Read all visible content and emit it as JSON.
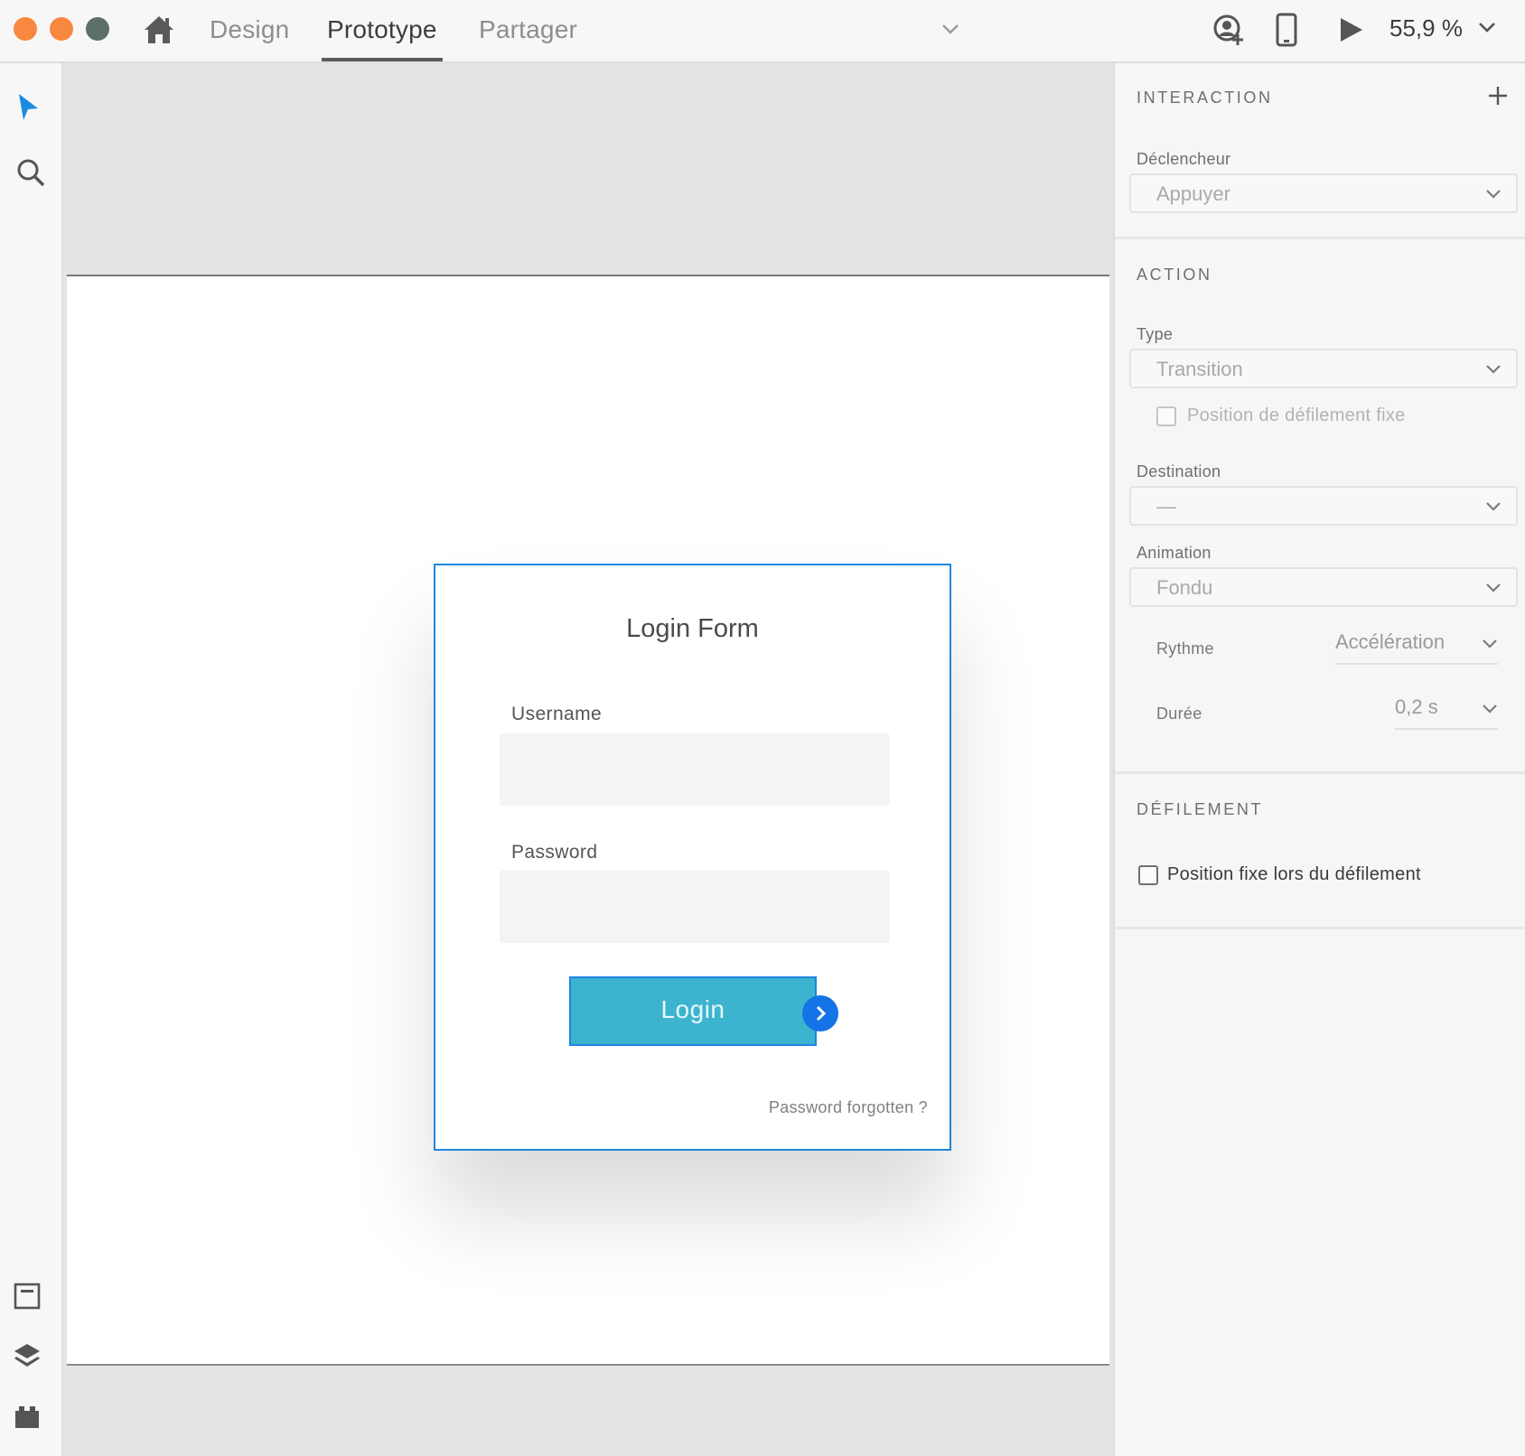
{
  "window": {
    "traffic_colors": [
      "#f8873f",
      "#f8873f",
      "#5c6f6a"
    ]
  },
  "topbar": {
    "tabs": [
      {
        "label": "Design"
      },
      {
        "label": "Prototype"
      },
      {
        "label": "Partager"
      }
    ],
    "active_tab": "Prototype",
    "zoom": "55,9 %",
    "icons": [
      "home-icon",
      "chevron-down-icon",
      "user-add-icon",
      "mobile-preview-icon",
      "play-icon",
      "chevron-down-icon"
    ]
  },
  "left_tools": {
    "icons": [
      "select-arrow-icon",
      "zoom-icon",
      "artboards-icon",
      "layers-icon",
      "plugins-icon"
    ],
    "accent_color": "#1d8ce0"
  },
  "artboard": {
    "card": {
      "title": "Login Form",
      "username_label": "Username",
      "password_label": "Password",
      "login_label": "Login",
      "forgot_label": "Password forgotten ?"
    },
    "selection_color": "#1d87e0",
    "button_color": "#3cb3cf"
  },
  "panel": {
    "interaction": {
      "title": "INTERACTION",
      "trigger_label": "Déclencheur",
      "trigger_value": "Appuyer"
    },
    "action": {
      "title": "ACTION",
      "type_label": "Type",
      "type_value": "Transition",
      "fixed_scroll_label": "Position de défilement fixe",
      "destination_label": "Destination",
      "destination_value": "—",
      "animation_label": "Animation",
      "animation_value": "Fondu",
      "easing_label": "Rythme",
      "easing_value": "Accélération",
      "duration_label": "Durée",
      "duration_value": "0,2 s"
    },
    "scroll": {
      "title": "DÉFILEMENT",
      "fixed_position_label": "Position fixe lors du défilement"
    }
  }
}
